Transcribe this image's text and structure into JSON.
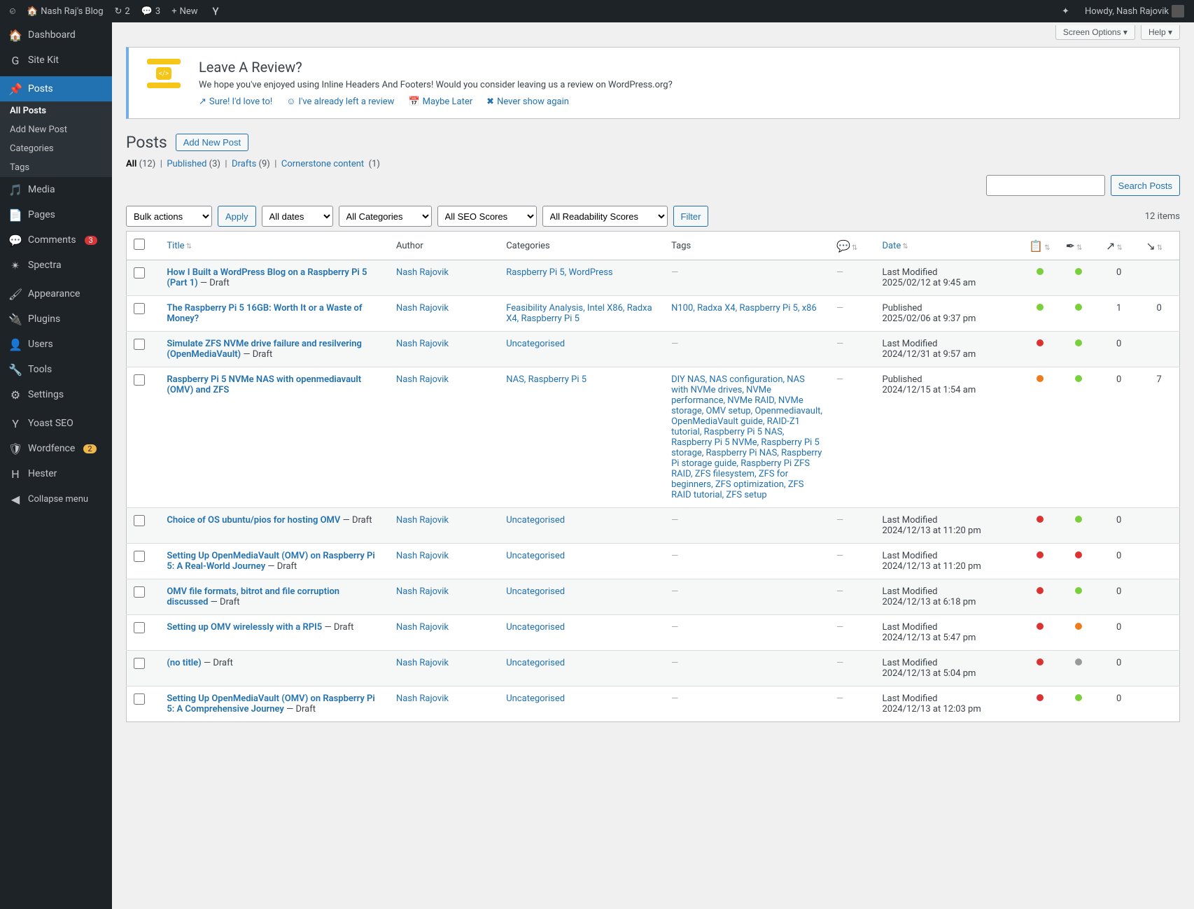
{
  "topbar": {
    "site_name": "Nash Raj's Blog",
    "updates": "2",
    "comments": "3",
    "new_label": "New",
    "greeting": "Howdy, Nash Rajovik"
  },
  "sidebar": {
    "items": [
      {
        "label": "Dashboard",
        "icon": "dashboard"
      },
      {
        "label": "Site Kit",
        "icon": "sitekit"
      },
      {
        "label": "Posts",
        "icon": "posts",
        "active": true,
        "submenu": [
          "All Posts",
          "Add New Post",
          "Categories",
          "Tags"
        ],
        "current_sub": 0
      },
      {
        "label": "Media",
        "icon": "media"
      },
      {
        "label": "Pages",
        "icon": "pages"
      },
      {
        "label": "Comments",
        "icon": "comments",
        "badge": "3",
        "badge_cls": "badge"
      },
      {
        "label": "Spectra",
        "icon": "spectra"
      },
      {
        "label": "Appearance",
        "icon": "appearance"
      },
      {
        "label": "Plugins",
        "icon": "plugins"
      },
      {
        "label": "Users",
        "icon": "users"
      },
      {
        "label": "Tools",
        "icon": "tools"
      },
      {
        "label": "Settings",
        "icon": "settings"
      },
      {
        "label": "Yoast SEO",
        "icon": "yoast"
      },
      {
        "label": "Wordfence",
        "icon": "wordfence",
        "badge": "2",
        "badge_cls": "badge-orange"
      },
      {
        "label": "Hester",
        "icon": "hester"
      }
    ],
    "collapse": "Collapse menu"
  },
  "corner": {
    "screen_options": "Screen Options ▾",
    "help": "Help ▾"
  },
  "notice": {
    "title": "Leave A Review?",
    "body": "We hope you've enjoyed using Inline Headers And Footers! Would you consider leaving us a review on WordPress.org?",
    "links": [
      "Sure! I'd love to!",
      "I've already left a review",
      "Maybe Later",
      "Never show again"
    ]
  },
  "page": {
    "heading": "Posts",
    "add_new": "Add New Post"
  },
  "subsubsub": {
    "all": "All",
    "all_count": "(12)",
    "published": "Published",
    "published_count": "(3)",
    "drafts": "Drafts",
    "drafts_count": "(9)",
    "cornerstone": "Cornerstone content",
    "cornerstone_count": "(1)"
  },
  "filters": {
    "bulk": "Bulk actions",
    "apply": "Apply",
    "dates": "All dates",
    "categories": "All Categories",
    "seo": "All SEO Scores",
    "readability": "All Readability Scores",
    "filter": "Filter",
    "items_count": "12 items",
    "search_btn": "Search Posts"
  },
  "columns": {
    "title": "Title",
    "author": "Author",
    "categories": "Categories",
    "tags": "Tags",
    "date": "Date"
  },
  "rows": [
    {
      "title": "How I Built a WordPress Blog on a Raspberry Pi 5 (Part 1)",
      "draft": " — Draft",
      "author": "Nash Rajovik",
      "categories": "Raspberry Pi 5, WordPress",
      "tags": "—",
      "comments": "—",
      "date1": "Last Modified",
      "date2": "2025/02/12 at 9:45 am",
      "seo": "green",
      "read": "green",
      "links": "0",
      "links2": ""
    },
    {
      "title": "The Raspberry Pi 5 16GB: Worth It or a Waste of Money?",
      "draft": "",
      "author": "Nash Rajovik",
      "categories": "Feasibility Analysis, Intel X86, Radxa X4, Raspberry Pi 5",
      "tags": "N100, Radxa X4, Raspberry Pi 5, x86",
      "comments": "—",
      "date1": "Published",
      "date2": "2025/02/06 at 9:37 pm",
      "seo": "green",
      "read": "green",
      "links": "1",
      "links2": "0"
    },
    {
      "title": "Simulate ZFS NVMe drive failure and resilvering (OpenMediaVault)",
      "draft": " — Draft",
      "author": "Nash Rajovik",
      "categories": "Uncategorised",
      "tags": "—",
      "comments": "—",
      "date1": "Last Modified",
      "date2": "2024/12/31 at 9:57 am",
      "seo": "red",
      "read": "green",
      "links": "0",
      "links2": ""
    },
    {
      "title": "Raspberry Pi 5 NVMe NAS with openmediavault (OMV) and ZFS",
      "draft": "",
      "author": "Nash Rajovik",
      "categories": "NAS, Raspberry Pi 5",
      "tags": "DIY NAS, NAS configuration, NAS with NVMe drives, NVMe performance, NVMe RAID, NVMe storage, OMV setup, Openmediavault, OpenMediaVault guide, RAID-Z1 tutorial, Raspberry Pi 5 NAS, Raspberry Pi 5 NVMe, Raspberry Pi 5 storage, Raspberry Pi NAS, Raspberry Pi storage guide, Raspberry Pi ZFS RAID, ZFS filesystem, ZFS for beginners, ZFS optimization, ZFS RAID tutorial, ZFS setup",
      "comments": "—",
      "date1": "Published",
      "date2": "2024/12/15 at 1:54 am",
      "seo": "orange",
      "read": "green",
      "links": "0",
      "links2": "7"
    },
    {
      "title": "Choice of OS ubuntu/pios for hosting OMV",
      "draft": " — Draft",
      "author": "Nash Rajovik",
      "categories": "Uncategorised",
      "tags": "—",
      "comments": "—",
      "date1": "Last Modified",
      "date2": "2024/12/13 at 11:20 pm",
      "seo": "red",
      "read": "green",
      "links": "0",
      "links2": ""
    },
    {
      "title": "Setting Up OpenMediaVault (OMV) on Raspberry Pi 5: A Real-World Journey",
      "draft": " — Draft",
      "author": "Nash Rajovik",
      "categories": "Uncategorised",
      "tags": "—",
      "comments": "—",
      "date1": "Last Modified",
      "date2": "2024/12/13 at 11:20 pm",
      "seo": "red",
      "read": "red",
      "links": "0",
      "links2": ""
    },
    {
      "title": "OMV file formats, bitrot and file corruption discussed",
      "draft": " — Draft",
      "author": "Nash Rajovik",
      "categories": "Uncategorised",
      "tags": "—",
      "comments": "—",
      "date1": "Last Modified",
      "date2": "2024/12/13 at 6:18 pm",
      "seo": "red",
      "read": "green",
      "links": "0",
      "links2": ""
    },
    {
      "title": "Setting up OMV wirelessly with a RPI5",
      "draft": " — Draft",
      "author": "Nash Rajovik",
      "categories": "Uncategorised",
      "tags": "—",
      "comments": "—",
      "date1": "Last Modified",
      "date2": "2024/12/13 at 5:47 pm",
      "seo": "red",
      "read": "orange",
      "links": "0",
      "links2": ""
    },
    {
      "title": "(no title)",
      "draft": " — Draft",
      "author": "Nash Rajovik",
      "categories": "Uncategorised",
      "tags": "—",
      "comments": "—",
      "date1": "Last Modified",
      "date2": "2024/12/13 at 5:04 pm",
      "seo": "red",
      "read": "grey",
      "links": "0",
      "links2": ""
    },
    {
      "title": "Setting Up OpenMediaVault (OMV) on Raspberry Pi 5: A Comprehensive Journey",
      "draft": " — Draft",
      "author": "Nash Rajovik",
      "categories": "Uncategorised",
      "tags": "—",
      "comments": "—",
      "date1": "Last Modified",
      "date2": "2024/12/13 at 12:03 pm",
      "seo": "red",
      "read": "green",
      "links": "0",
      "links2": ""
    }
  ]
}
